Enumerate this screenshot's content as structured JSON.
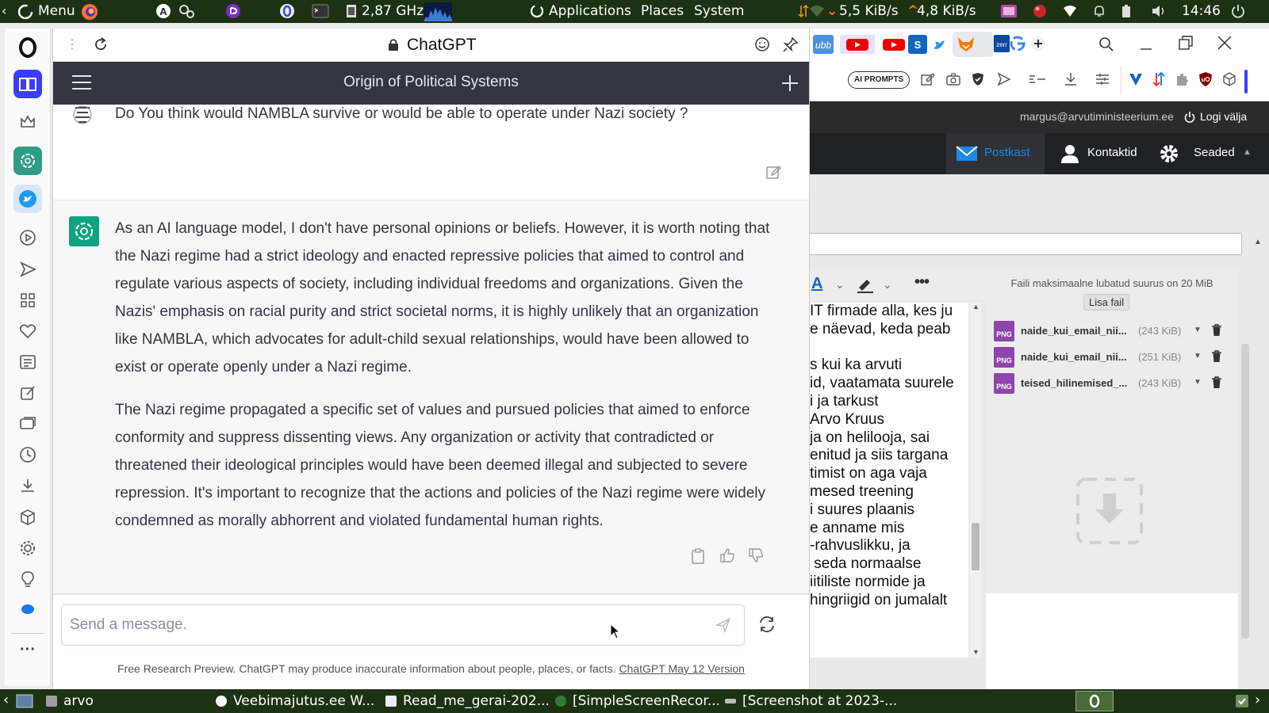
{
  "top_panel": {
    "menu_label": "Menu",
    "cpu_freq": "2,87 GHz",
    "applications": "Applications",
    "places": "Places",
    "system": "System",
    "net_down": "5,5 KiB/s",
    "net_up": "4,8 KiB/s",
    "time": "14:46"
  },
  "chat_tab": {
    "site_title": "ChatGPT"
  },
  "chat_header": {
    "title": "Origin of Political Systems"
  },
  "user_message": {
    "text": "Do You think would NAMBLA survive or would be able to operate under Nazi society ?"
  },
  "ai_message": {
    "paragraph1": "As an AI language model, I don't have personal opinions or beliefs. However, it is worth noting that the Nazi regime had a strict ideology and enacted repressive policies that aimed to control and regulate various aspects of society, including individual freedoms and organizations. Given the Nazis' emphasis on racial purity and strict societal norms, it is highly unlikely that an organization like NAMBLA, which advocates for adult-child sexual relationships, would have been allowed to exist or operate openly under a Nazi regime.",
    "paragraph2": "The Nazi regime propagated a specific set of values and pursued policies that aimed to enforce conformity and suppress dissenting views. Any organization or activity that contradicted or threatened their ideological principles would have been deemed illegal and subjected to severe repression. It's important to recognize that the actions and policies of the Nazi regime were widely condemned as morally abhorrent and violated fundamental human rights."
  },
  "composer": {
    "placeholder": "Send a message."
  },
  "footer": {
    "text": "Free Research Preview. ChatGPT may produce inaccurate information about people, places, or facts.",
    "link": "ChatGPT May 12 Version"
  },
  "mail": {
    "ai_prompts": "AI PROMPTS",
    "user_email": "margus@arvutiministeerium.ee",
    "logout": "Logi välja",
    "nav": [
      "Postkast",
      "Kontaktid",
      "Seaded"
    ],
    "max_size_note": "Faili maksimaalne lubatud suurus on 20 MiB",
    "add_file": "Lisa fail",
    "attachments": [
      {
        "type": "PNG",
        "name": "naide_kui_email_nii...",
        "size": "(243 KiB)"
      },
      {
        "type": "PNG",
        "name": "naide_kui_email_nii...",
        "size": "(251 KiB)"
      },
      {
        "type": "PNG",
        "name": "teised_hilinemised_...",
        "size": "(243 KiB)"
      }
    ],
    "editor_lines": [
      "IT firmade alla, kes ju",
      "e näevad, keda peab",
      "",
      "s kui ka arvuti",
      "id, vaatamata suurele",
      "i ja tarkust",
      "Arvo Kruus",
      "ja on helilooja, sai",
      "enitud ja siis targana",
      "timist on aga vaja",
      "mesed treening",
      "i suures plaanis",
      "e anname mis",
      "-rahvuslikku, ja",
      " seda normaalse",
      "iitiliste normide ja",
      "hingriigid on jumalalt"
    ]
  },
  "taskbar": {
    "items": [
      "arvo",
      "Veebimajutus.ee W...",
      "Read_me_gerai-202...",
      "[SimpleScreenRecor...",
      "[Screenshot at 2023-..."
    ]
  },
  "colors": {
    "panel_bg": "#1d3212",
    "chat_header_bg": "#343541",
    "gpt_green": "#10a37f",
    "mail_dark": "#202124",
    "mail_accent": "#1e88e5",
    "png_badge": "#8e44ad"
  }
}
